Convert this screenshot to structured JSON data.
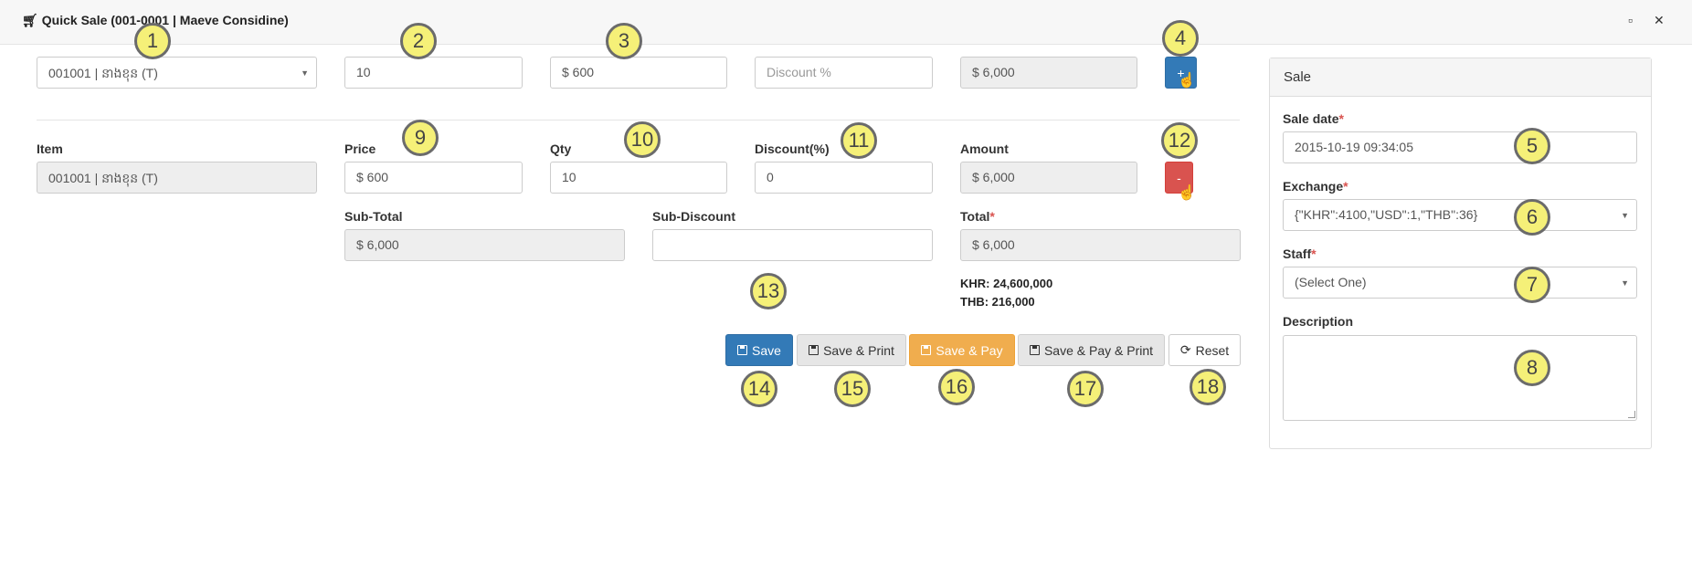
{
  "window": {
    "title": "Quick Sale (001-0001 | Maeve Considine)",
    "restore_glyph": "▫",
    "close_glyph": "✕"
  },
  "entry_row": {
    "item_value": "001001 | នាងខុន (T)",
    "qty_value": "10",
    "price_value": "$ 600",
    "discount_placeholder": "Discount %",
    "amount_value": "$ 6,000",
    "add_label": "+"
  },
  "line": {
    "item_label": "Item",
    "item_value": "001001 | នាងខុន (T)",
    "price_label": "Price",
    "price_value": "$ 600",
    "qty_label": "Qty",
    "qty_value": "10",
    "discount_label": "Discount(%)",
    "discount_value": "0",
    "amount_label": "Amount",
    "amount_value": "$ 6,000",
    "remove_label": "-"
  },
  "summary": {
    "subtotal_label": "Sub-Total",
    "subtotal_value": "$ 6,000",
    "subdiscount_label": "Sub-Discount",
    "subdiscount_value": "",
    "total_label": "Total",
    "total_value": "$ 6,000",
    "khr_text": "KHR: 24,600,000",
    "thb_text": "THB: 216,000"
  },
  "actions": {
    "save": "Save",
    "save_print": "Save & Print",
    "save_pay": "Save & Pay",
    "save_pay_print": "Save & Pay & Print",
    "reset": "Reset"
  },
  "sale_panel": {
    "heading": "Sale",
    "date_label": "Sale date",
    "date_value": "2015-10-19 09:34:05",
    "exchange_label": "Exchange",
    "exchange_value": "{\"KHR\":4100,\"USD\":1,\"THB\":36}",
    "staff_label": "Staff",
    "staff_value": "(Select One)",
    "description_label": "Description",
    "description_value": "",
    "required_mark": "*"
  },
  "badges": [
    "1",
    "2",
    "3",
    "4",
    "5",
    "6",
    "7",
    "8",
    "9",
    "10",
    "11",
    "12",
    "13",
    "14",
    "15",
    "16",
    "17",
    "18"
  ],
  "colors": {
    "primary": "#337ab7",
    "danger": "#d9534f",
    "warning": "#f0ad4e",
    "badge": "#f5f078"
  }
}
